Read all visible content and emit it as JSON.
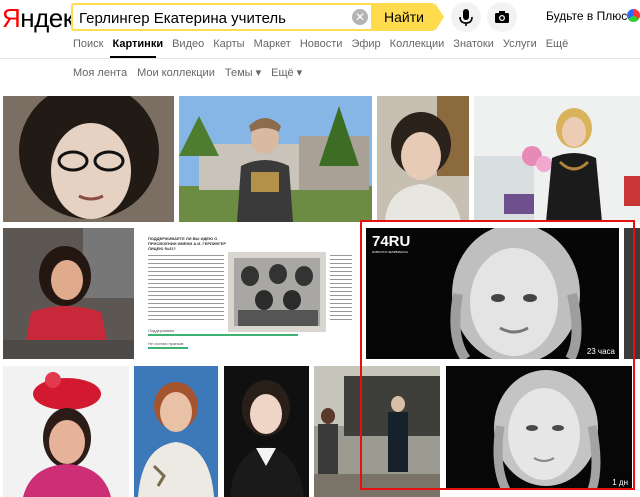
{
  "header": {
    "logo_first": "Я",
    "logo_rest": "ндекс",
    "search_value": "Герлингер Екатерина учитель",
    "search_button": "Найти",
    "plus_link": "Будьте в Плюсе"
  },
  "tabs": [
    "Поиск",
    "Картинки",
    "Видео",
    "Карты",
    "Маркет",
    "Новости",
    "Эфир",
    "Коллекции",
    "Знатоки",
    "Услуги",
    "Ещё"
  ],
  "active_tab": "Картинки",
  "subnav": {
    "feed": "Моя лента",
    "collections": "Мои коллекции",
    "topics": "Темы ▾",
    "more": "Ещё ▾"
  },
  "results": {
    "preview_badge_source": "74RU",
    "preview_badge_caption": "НОВОСТИ ЧЕЛЯБИНСКА",
    "preview_time": "23 часа",
    "document_heading": "ПОДДЕРЖИВАЕТЕ ЛИ ВЫ ИДЕЮ О ПРИСВОЕНИИ ИМЕНИ А.И. ГЕРЛИНГЕР ЛИЦЕЮ №31?",
    "document_vote_yes": "Поддерживаю",
    "document_vote_no": "Не считаю нужным",
    "last_badge": "1 дн"
  },
  "colors": {
    "search_accent": "#ffdb4d",
    "highlight_frame": "#e51010",
    "logo_red": "#ff0000"
  }
}
